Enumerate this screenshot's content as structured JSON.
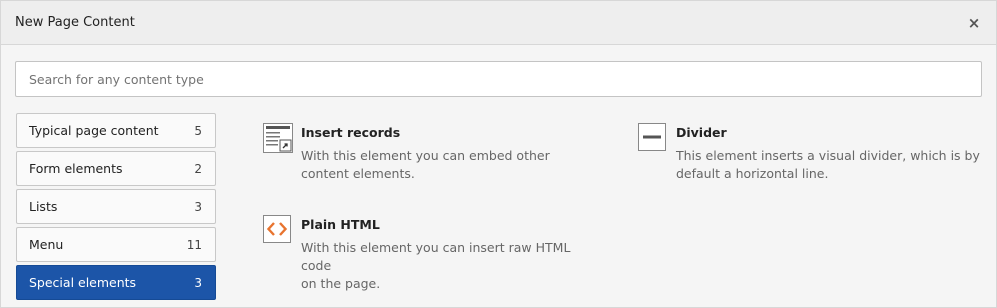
{
  "header": {
    "title": "New Page Content",
    "close_label": "×"
  },
  "search": {
    "placeholder": "Search for any content type",
    "value": ""
  },
  "categories": [
    {
      "label": "Typical page content",
      "count": "5"
    },
    {
      "label": "Form elements",
      "count": "2"
    },
    {
      "label": "Lists",
      "count": "3"
    },
    {
      "label": "Menu",
      "count": "11"
    },
    {
      "label": "Special elements",
      "count": "3"
    }
  ],
  "active_category": "Special elements",
  "elements": [
    {
      "icon": "insert-records-icon",
      "title": "Insert records",
      "desc_line1": "With this element you can embed other",
      "desc_line2": "content elements."
    },
    {
      "icon": "divider-icon",
      "title": "Divider",
      "desc_line1": "This element inserts a visual divider, which is by",
      "desc_line2": "default a horizontal line."
    },
    {
      "icon": "html-code-icon",
      "title": "Plain HTML",
      "desc_line1": "With this element you can insert raw HTML code",
      "desc_line2": "on the page."
    }
  ],
  "colors": {
    "accent": "#1c55a8",
    "html_icon": "#e8742f"
  }
}
